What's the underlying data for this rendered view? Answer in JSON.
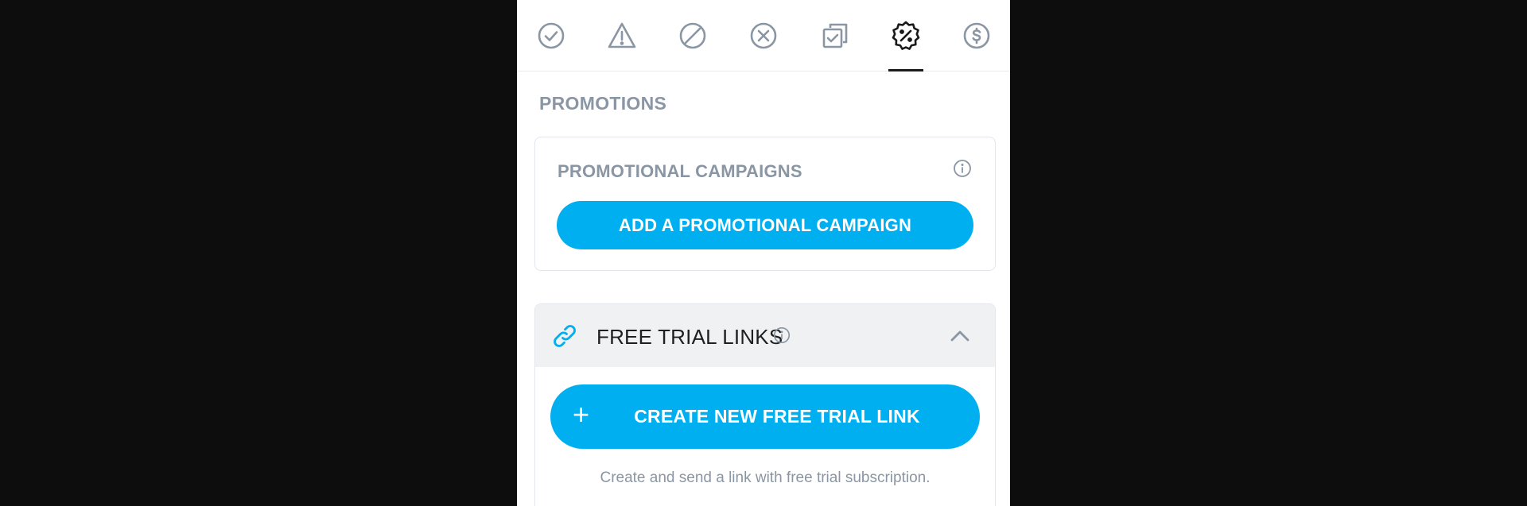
{
  "tabs": [
    {
      "icon": "check-circle-icon"
    },
    {
      "icon": "warning-triangle-icon"
    },
    {
      "icon": "blocked-icon"
    },
    {
      "icon": "close-circle-icon"
    },
    {
      "icon": "copy-check-icon"
    },
    {
      "icon": "percent-badge-icon",
      "active": true
    },
    {
      "icon": "dollar-circle-icon"
    }
  ],
  "section": {
    "title": "PROMOTIONS"
  },
  "campaigns": {
    "title": "PROMOTIONAL CAMPAIGNS",
    "button_label": "ADD A PROMOTIONAL CAMPAIGN"
  },
  "free_trial": {
    "title": "FREE TRIAL LINKS",
    "button_label": "CREATE NEW FREE TRIAL LINK",
    "button_icon": "+",
    "description": "Create and send a link with free trial subscription."
  },
  "colors": {
    "accent": "#00aff0",
    "muted_text": "#8a96a3",
    "icon": "#8a96a3",
    "active_icon": "#1a1a1a",
    "background": "#0d0d0d"
  }
}
